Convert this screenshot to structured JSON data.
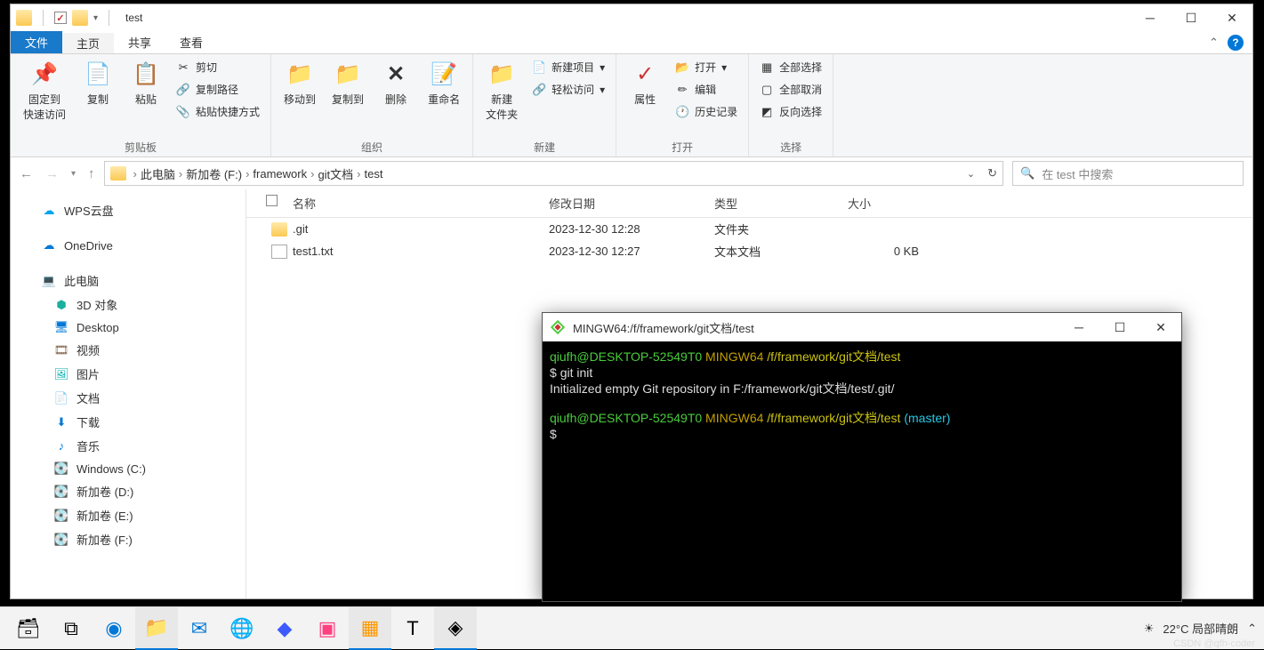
{
  "window": {
    "title": "test"
  },
  "tabs": {
    "file": "文件",
    "home": "主页",
    "share": "共享",
    "view": "查看"
  },
  "ribbon": {
    "clipboard": {
      "label": "剪贴板",
      "pin": "固定到\n快速访问",
      "copy": "复制",
      "paste": "粘贴",
      "cut": "剪切",
      "copyPath": "复制路径",
      "pasteShortcut": "粘贴快捷方式"
    },
    "organize": {
      "label": "组织",
      "moveto": "移动到",
      "copyto": "复制到",
      "delete": "删除",
      "rename": "重命名"
    },
    "new": {
      "label": "新建",
      "newFolder": "新建\n文件夹",
      "newItem": "新建项目",
      "easyAccess": "轻松访问"
    },
    "open": {
      "label": "打开",
      "properties": "属性",
      "open": "打开",
      "edit": "编辑",
      "history": "历史记录"
    },
    "select": {
      "label": "选择",
      "selectAll": "全部选择",
      "selectNone": "全部取消",
      "invert": "反向选择"
    }
  },
  "breadcrumb": [
    "此电脑",
    "新加卷 (F:)",
    "framework",
    "git文档",
    "test"
  ],
  "search": {
    "placeholder": "在 test 中搜索"
  },
  "sidebar": {
    "wps": "WPS云盘",
    "onedrive": "OneDrive",
    "thispc": "此电脑",
    "items": [
      "3D 对象",
      "Desktop",
      "视频",
      "图片",
      "文档",
      "下载",
      "音乐",
      "Windows (C:)",
      "新加卷 (D:)",
      "新加卷 (E:)",
      "新加卷 (F:)"
    ]
  },
  "columns": {
    "name": "名称",
    "date": "修改日期",
    "type": "类型",
    "size": "大小"
  },
  "files": [
    {
      "name": ".git",
      "date": "2023-12-30 12:28",
      "type": "文件夹",
      "size": "",
      "icon": "folder"
    },
    {
      "name": "test1.txt",
      "date": "2023-12-30 12:27",
      "type": "文本文档",
      "size": "0 KB",
      "icon": "txt"
    }
  ],
  "terminal": {
    "title": "MINGW64:/f/framework/git文档/test",
    "user": "qiufh@DESKTOP-52549T0",
    "host": "MINGW64",
    "path": "/f/framework/git文档/test",
    "branch": "(master)",
    "cmd": "git init",
    "output": "Initialized empty Git repository in F:/framework/git文档/test/.git/"
  },
  "taskbar": {
    "weather": "22°C  局部晴朗"
  },
  "watermark": "CSDN @qfh-coder"
}
